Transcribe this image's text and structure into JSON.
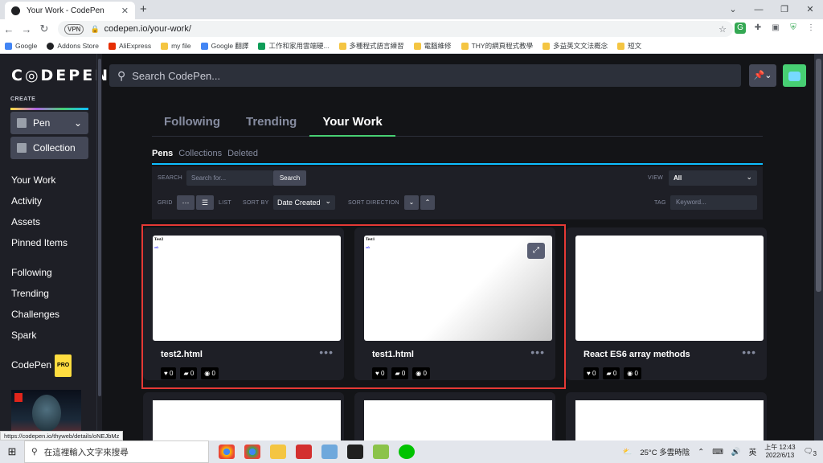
{
  "browser": {
    "tab_title": "Your Work - CodePen",
    "url": "codepen.io/your-work/",
    "vpn": "VPN",
    "status_url": "https://codepen.io/thyweb/details/oNEJbMz"
  },
  "bookmarks": [
    "Google",
    "Addons Store",
    "AliExpress",
    "my file",
    "Google 翻譯",
    "工作和家用雲端硬...",
    "多種程式語言練習",
    "電腦維修",
    "THY的網頁程式教學",
    "多益英文文法概念",
    "短文"
  ],
  "sidebar": {
    "logo": "C◎DEPEN",
    "create": "CREATE",
    "pen": "Pen",
    "collection": "Collection",
    "nav1": [
      "Your Work",
      "Activity",
      "Assets",
      "Pinned Items"
    ],
    "nav2": [
      "Following",
      "Trending",
      "Challenges",
      "Spark"
    ],
    "codepen": "CodePen",
    "pro": "PRO"
  },
  "header": {
    "search_placeholder": "Search CodePen..."
  },
  "main_tabs": [
    "Following",
    "Trending",
    "Your Work"
  ],
  "sub_tabs": [
    "Pens",
    "Collections",
    "Deleted"
  ],
  "filters": {
    "search_label": "SEARCH",
    "search_placeholder": "Search for...",
    "search_button": "Search",
    "view_label": "VIEW",
    "view_value": "All",
    "grid": "GRID",
    "list": "LIST",
    "sort_by": "SORT BY",
    "sort_value": "Date Created",
    "sort_direction": "SORT DIRECTION",
    "tag": "TAG",
    "tag_placeholder": "Keyword..."
  },
  "cards": [
    {
      "title": "test2.html",
      "preview_title": "Test2",
      "preview_sub": "ask",
      "likes": "0",
      "comments": "0",
      "views": "0"
    },
    {
      "title": "test1.html",
      "preview_title": "Test1",
      "preview_sub": "ask",
      "likes": "0",
      "comments": "0",
      "views": "0"
    },
    {
      "title": "React ES6 array methods",
      "preview_title": "",
      "preview_sub": "",
      "likes": "0",
      "comments": "0",
      "views": "0"
    }
  ],
  "taskbar": {
    "search_placeholder": "在這裡輸入文字來搜尋",
    "weather": "25°C 多雲時陰",
    "ime": "英",
    "time": "上午 12:43",
    "date": "2022/6/13",
    "notif": "3"
  }
}
